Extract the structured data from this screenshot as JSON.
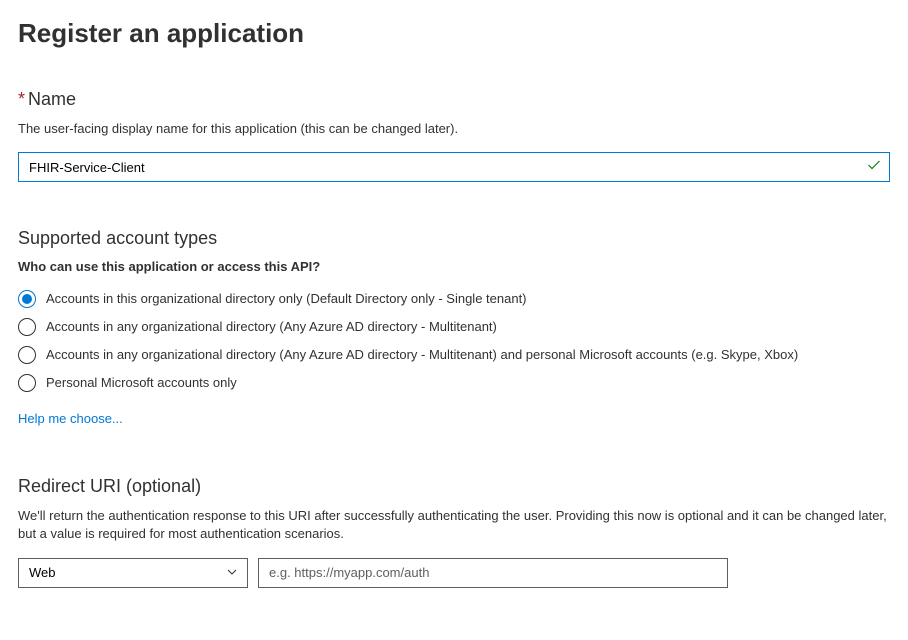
{
  "page": {
    "title": "Register an application"
  },
  "nameSection": {
    "label": "Name",
    "description": "The user-facing display name for this application (this can be changed later).",
    "value": "FHIR-Service-Client"
  },
  "accountTypes": {
    "heading": "Supported account types",
    "question": "Who can use this application or access this API?",
    "options": [
      {
        "label": "Accounts in this organizational directory only (Default Directory only - Single tenant)",
        "selected": true
      },
      {
        "label": "Accounts in any organizational directory (Any Azure AD directory - Multitenant)",
        "selected": false
      },
      {
        "label": "Accounts in any organizational directory (Any Azure AD directory - Multitenant) and personal Microsoft accounts (e.g. Skype, Xbox)",
        "selected": false
      },
      {
        "label": "Personal Microsoft accounts only",
        "selected": false
      }
    ],
    "helpLink": "Help me choose..."
  },
  "redirect": {
    "heading": "Redirect URI (optional)",
    "description": "We'll return the authentication response to this URI after successfully authenticating the user. Providing this now is optional and it can be changed later, but a value is required for most authentication scenarios.",
    "platform": "Web",
    "uriPlaceholder": "e.g. https://myapp.com/auth",
    "uriValue": ""
  }
}
